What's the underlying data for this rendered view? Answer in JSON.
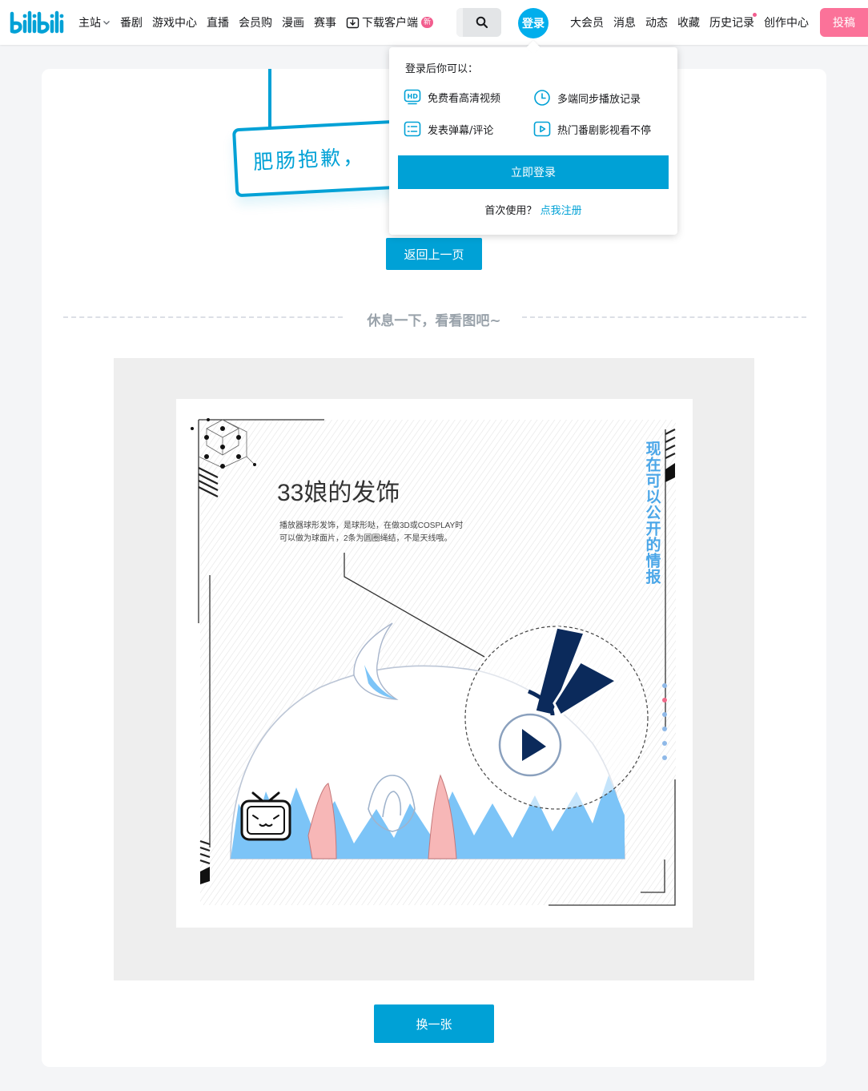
{
  "header": {
    "nav_left": [
      {
        "label": "主站"
      },
      {
        "label": "番剧"
      },
      {
        "label": "游戏中心"
      },
      {
        "label": "直播"
      },
      {
        "label": "会员购"
      },
      {
        "label": "漫画"
      },
      {
        "label": "赛事"
      },
      {
        "label": "下载客户端"
      }
    ],
    "new_badge": "新",
    "login_avatar": "登录",
    "nav_right": [
      {
        "label": "大会员"
      },
      {
        "label": "消息"
      },
      {
        "label": "动态"
      },
      {
        "label": "收藏"
      },
      {
        "label": "历史记录"
      },
      {
        "label": "创作中心"
      }
    ],
    "upload_label": "投稿"
  },
  "login_popup": {
    "title": "登录后你可以：",
    "benefits": [
      {
        "label": "免费看高清视频",
        "icon": "hd-icon"
      },
      {
        "label": "多端同步播放记录",
        "icon": "clock-icon"
      },
      {
        "label": "发表弹幕/评论",
        "icon": "list-icon"
      },
      {
        "label": "热门番剧影视看不停",
        "icon": "play-icon"
      }
    ],
    "login_button": "立即登录",
    "register_prompt": "首次使用？",
    "register_link": "点我注册"
  },
  "main": {
    "sign_text": "肥肠抱歉，",
    "back_button": "返回上一页",
    "divider_text": "休息一下，看看图吧~",
    "change_button": "换一张"
  },
  "illustration": {
    "title": "33娘的发饰",
    "desc_line1": "播放器球形发饰，是球形哒，在做3D或COSPLAY时",
    "desc_line2": "可以做为球面片，2条为圆圈绳结，不是天线哦。",
    "vertical_text": "现在可以公开的情报"
  },
  "colors": {
    "accent": "#00a1d6",
    "login_circle": "#00aeec",
    "upload": "#fb7299",
    "badge": "#f25d8e"
  }
}
